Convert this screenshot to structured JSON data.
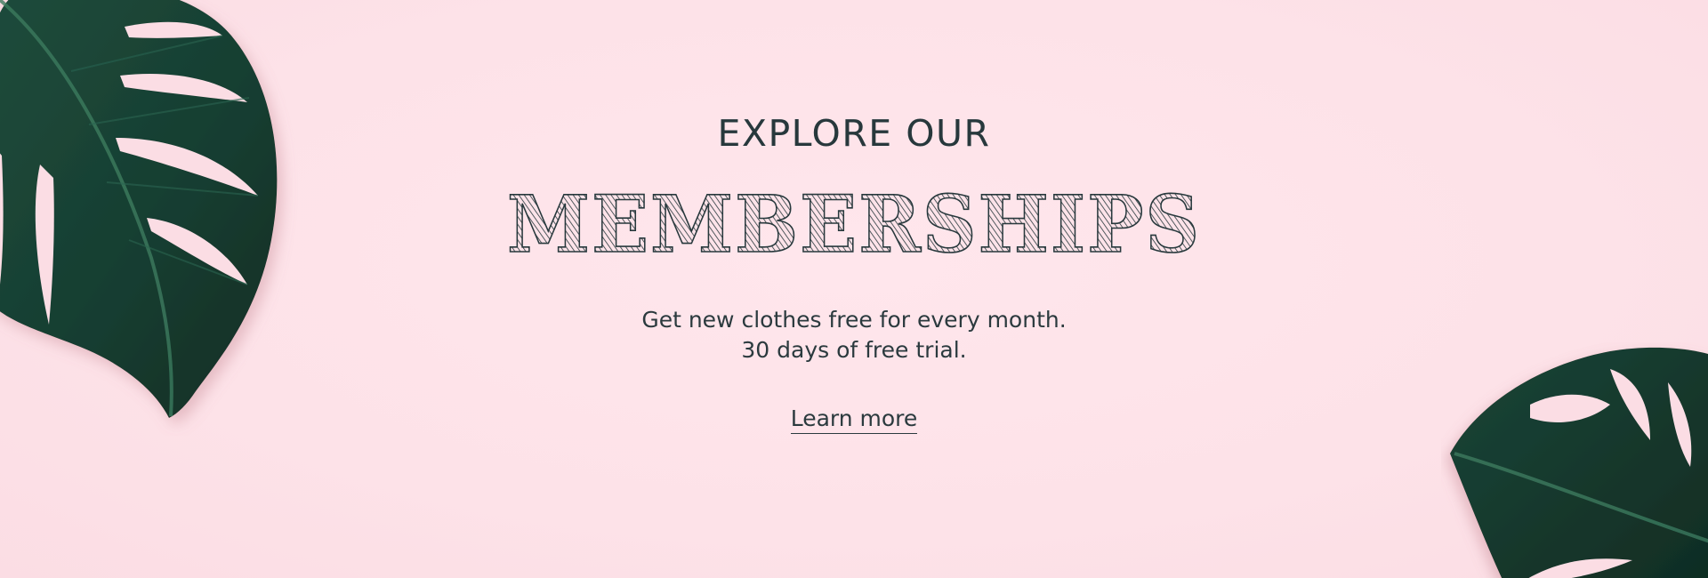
{
  "banner": {
    "eyebrow": "EXPLORE OUR",
    "headline": "MEMBERSHIPS",
    "description_line_1": "Get new clothes free for every month.",
    "description_line_2": "30 days of free trial.",
    "cta_label": "Learn more"
  },
  "colors": {
    "background": "#fde3e9",
    "text": "#27383c",
    "leaf_dark": "#163a30",
    "leaf_mid": "#21513f",
    "leaf_highlight": "#3c7a5e"
  },
  "icons": {
    "left_decoration": "monstera-leaf-icon",
    "right_decoration": "monstera-leaf-icon"
  }
}
